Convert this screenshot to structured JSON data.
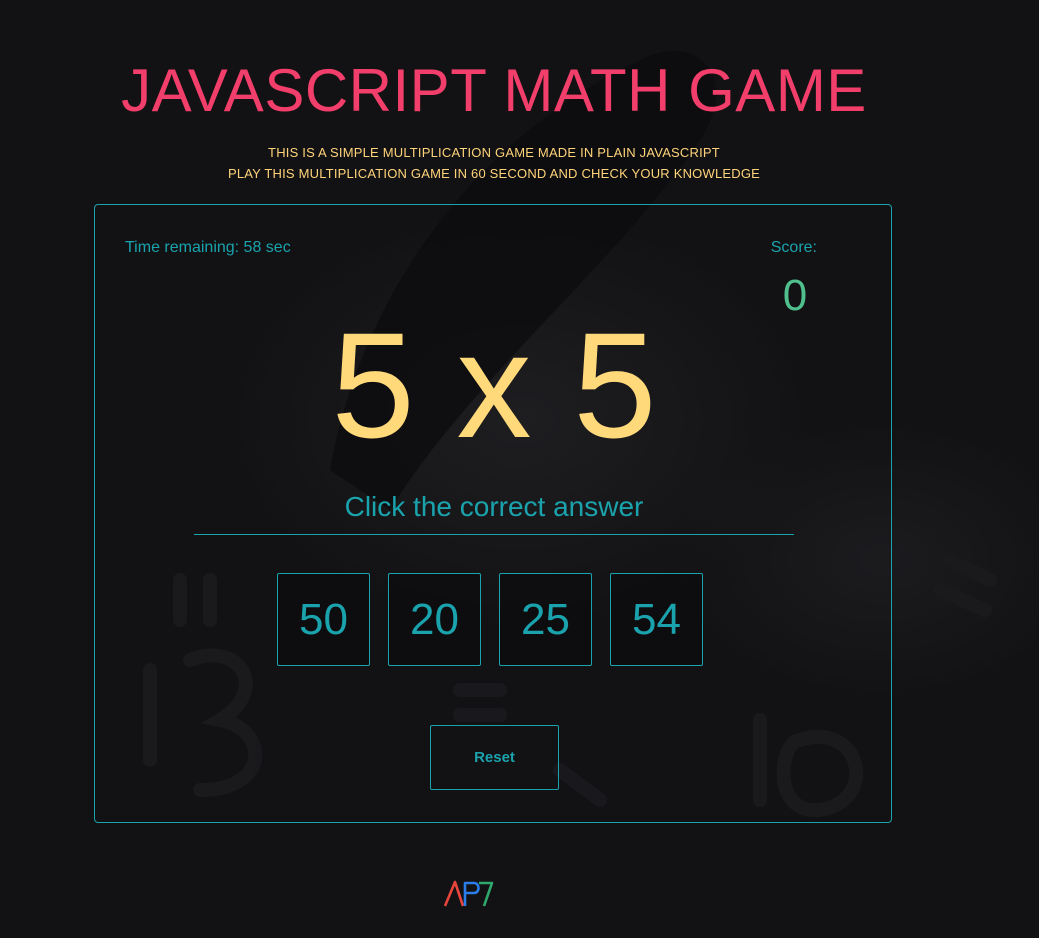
{
  "header": {
    "title": "JAVASCRIPT MATH GAME",
    "subtitle_line1": "THIS IS A SIMPLE MULTIPLICATION GAME MADE IN PLAIN JAVASCRIPT",
    "subtitle_line2": "PLAY THIS MULTIPLICATION GAME IN 60 SECOND AND CHECK YOUR KNOWLEDGE"
  },
  "game": {
    "time_remaining": "Time remaining: 58 sec",
    "score_label": "Score:",
    "score_value": "0",
    "question": "5 x 5",
    "instruction": "Click the correct answer",
    "choices": [
      "50",
      "20",
      "25",
      "54"
    ],
    "reset_label": "Reset"
  },
  "footer": {
    "logo_text": "AP7",
    "logo_icon": "ap7-logo-icon"
  },
  "colors": {
    "background": "#121214",
    "title": "#f23e6a",
    "subtitle": "#ffd37a",
    "accent": "#1aa3ad",
    "question": "#ffd97a",
    "score": "#4fc08d"
  }
}
